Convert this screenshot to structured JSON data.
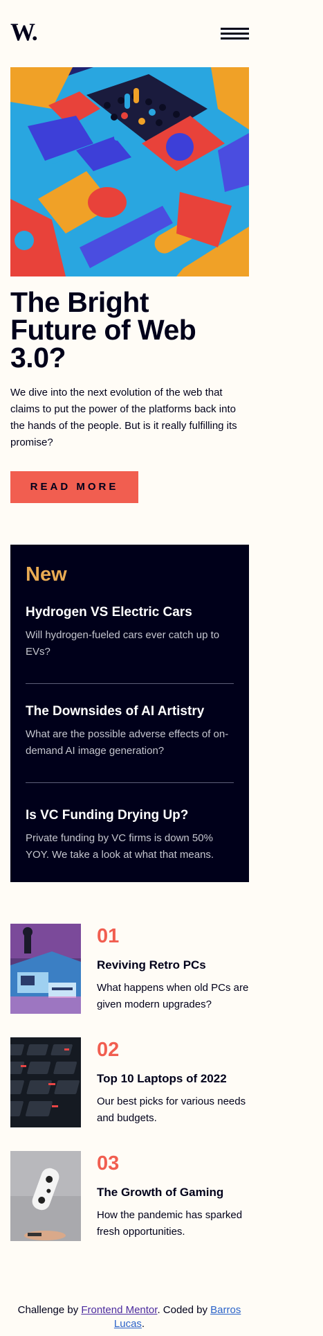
{
  "header": {
    "logo_text": "W.",
    "menu_icon": "hamburger-menu-icon"
  },
  "hero": {
    "image": "abstract-3d-web3-illustration",
    "title_line1": "The Bright",
    "title_line2": "Future of Web",
    "title_line3": "3.0?",
    "description": "We dive into the next evolution of the web that claims to put the power of the platforms back into the hands of the people. But is it really fulfilling its promise?",
    "read_more_label": "READ MORE"
  },
  "new_section": {
    "title": "New",
    "items": [
      {
        "title": "Hydrogen VS Electric Cars",
        "description": "Will hydrogen-fueled cars ever catch up to EVs?"
      },
      {
        "title": "The Downsides of AI Artistry",
        "description": "What are the possible adverse effects of on-demand AI image generation?"
      },
      {
        "title": "Is VC Funding Drying Up?",
        "description": "Private funding by VC firms is down 50% YOY. We take a look at what that means."
      }
    ]
  },
  "numbered": {
    "items": [
      {
        "number": "01",
        "title": "Reviving Retro PCs",
        "description": "What happens when old PCs are given modern upgrades?",
        "image": "retro-pc-photo"
      },
      {
        "number": "02",
        "title": "Top 10 Laptops of 2022",
        "description": "Our best picks for various needs and budgets.",
        "image": "laptop-keyboard-photo"
      },
      {
        "number": "03",
        "title": "The Growth of Gaming",
        "description": "How the pandemic has sparked fresh opportunities.",
        "image": "gaming-controller-photo"
      }
    ]
  },
  "footer": {
    "prefix": "Challenge by ",
    "challenge_link": "Frontend Mentor",
    "middle": ". Coded by ",
    "author_link_line1": "Barros",
    "author_link_line2": "Lucas",
    "suffix": "."
  },
  "colors": {
    "background": "#fffcf6",
    "dark": "#00001a",
    "accent_red": "#f15e50",
    "accent_orange": "#e9ab53"
  }
}
